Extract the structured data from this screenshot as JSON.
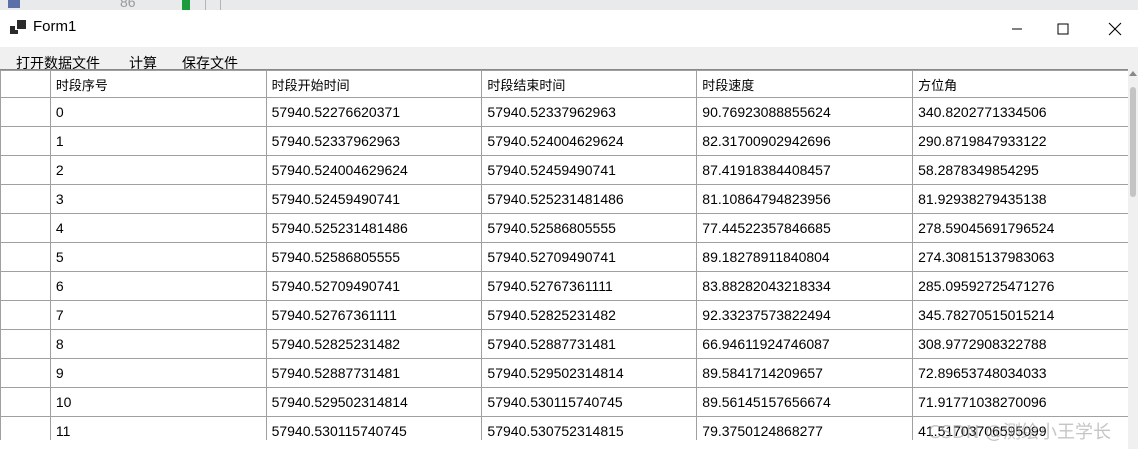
{
  "background": {
    "partial_number": "86"
  },
  "window": {
    "title": "Form1",
    "controls": [
      "minimize-icon",
      "maximize-icon",
      "close-icon"
    ]
  },
  "menu": {
    "items": [
      "打开数据文件",
      "计算",
      "保存文件"
    ]
  },
  "table": {
    "columns": [
      "时段序号",
      "时段开始时间",
      "时段结束时间",
      "时段速度",
      "方位角"
    ],
    "rows": [
      [
        "0",
        "57940.52276620371",
        "57940.52337962963",
        "90.76923088855624",
        "340.8202771334506"
      ],
      [
        "1",
        "57940.52337962963",
        "57940.524004629624",
        "82.31700902942696",
        "290.8719847933122"
      ],
      [
        "2",
        "57940.524004629624",
        "57940.52459490741",
        "87.41918384408457",
        "58.2878349854295"
      ],
      [
        "3",
        "57940.52459490741",
        "57940.525231481486",
        "81.10864794823956",
        "81.92938279435138"
      ],
      [
        "4",
        "57940.525231481486",
        "57940.52586805555",
        "77.44522357846685",
        "278.59045691796524"
      ],
      [
        "5",
        "57940.52586805555",
        "57940.52709490741",
        "89.18278911840804",
        "274.30815137983063"
      ],
      [
        "6",
        "57940.52709490741",
        "57940.52767361111",
        "83.88282043218334",
        "285.09592725471276"
      ],
      [
        "7",
        "57940.52767361111",
        "57940.52825231482",
        "92.33237573822494",
        "345.78270515015214"
      ],
      [
        "8",
        "57940.52825231482",
        "57940.52887731481",
        "66.94611924746087",
        "308.9772908322788"
      ],
      [
        "9",
        "57940.52887731481",
        "57940.529502314814",
        "89.5841714209657",
        "72.89653748034033"
      ],
      [
        "10",
        "57940.529502314814",
        "57940.530115740745",
        "89.56145157656674",
        "71.91771038270096"
      ],
      [
        "11",
        "57940.530115740745",
        "57940.530752314815",
        "79.3750124868277",
        "41.51703706595099"
      ]
    ]
  },
  "watermark": "CSDN @测绘小王学长"
}
